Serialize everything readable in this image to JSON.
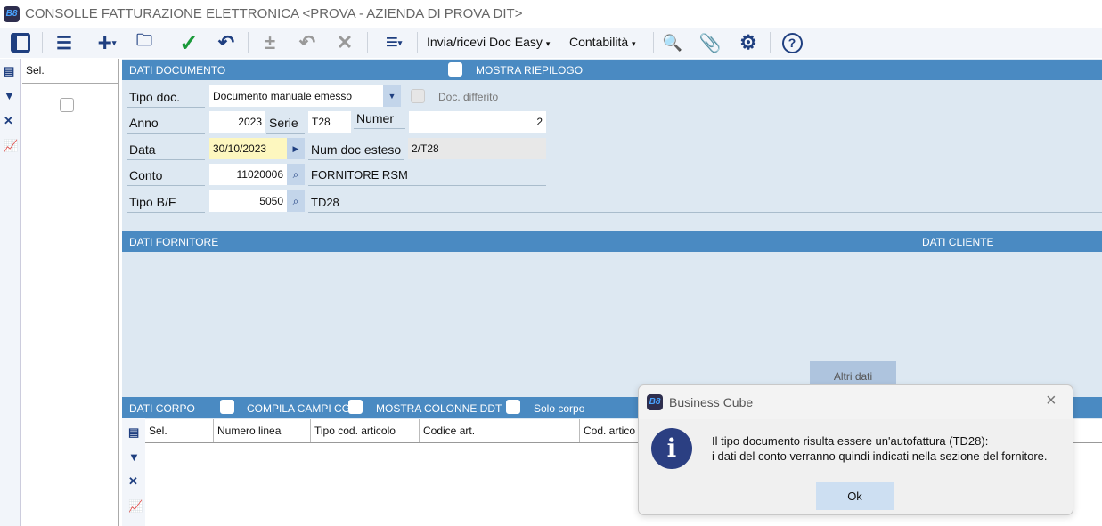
{
  "window": {
    "title": "CONSOLLE FATTURAZIONE ELETTRONICA <PROVA - AZIENDA DI PROVA DIT>",
    "logo": "B8"
  },
  "toolbar": {
    "menu1": "Invia/ricevi Doc Easy",
    "menu2": "Contabilità"
  },
  "left_list": {
    "header": "Sel."
  },
  "dati_documento": {
    "title": "DATI DOCUMENTO",
    "mostra_riepilogo": "MOSTRA RIEPILOGO",
    "tipo_doc_label": "Tipo doc.",
    "tipo_doc_value": "Documento manuale emesso",
    "doc_differito": "Doc. differito",
    "anno_label": "Anno",
    "anno_value": "2023",
    "serie_label": "Serie",
    "serie_value": "T28",
    "numer_label": "Numer",
    "numer_value": "2",
    "data_label": "Data",
    "data_value": "30/10/2023",
    "num_doc_esteso_label": "Num doc esteso",
    "num_doc_esteso_value": "2/T28",
    "conto_label": "Conto",
    "conto_value": "11020006",
    "conto_desc": "FORNITORE RSM",
    "tipo_bf_label": "Tipo B/F",
    "tipo_bf_value": "5050",
    "tipo_bf_desc": "TD28"
  },
  "dati_fornitore": {
    "title": "DATI FORNITORE",
    "cliente_title": "DATI CLIENTE",
    "altri_dati": "Altri dati"
  },
  "dati_corpo": {
    "title": "DATI CORPO",
    "compila": "COMPILA CAMPI CG",
    "mostra_colonne": "MOSTRA COLONNE DDT",
    "solo_corpo": "Solo corpo",
    "columns": [
      "Sel.",
      "Numero linea",
      "Tipo cod. articolo",
      "Codice art.",
      "Cod. artico"
    ]
  },
  "dialog": {
    "title": "Business Cube",
    "line1": "Il tipo documento risulta essere un'autofattura (TD28):",
    "line2": "i dati del conto verranno quindi indicati nella sezione del fornitore.",
    "ok": "Ok"
  }
}
